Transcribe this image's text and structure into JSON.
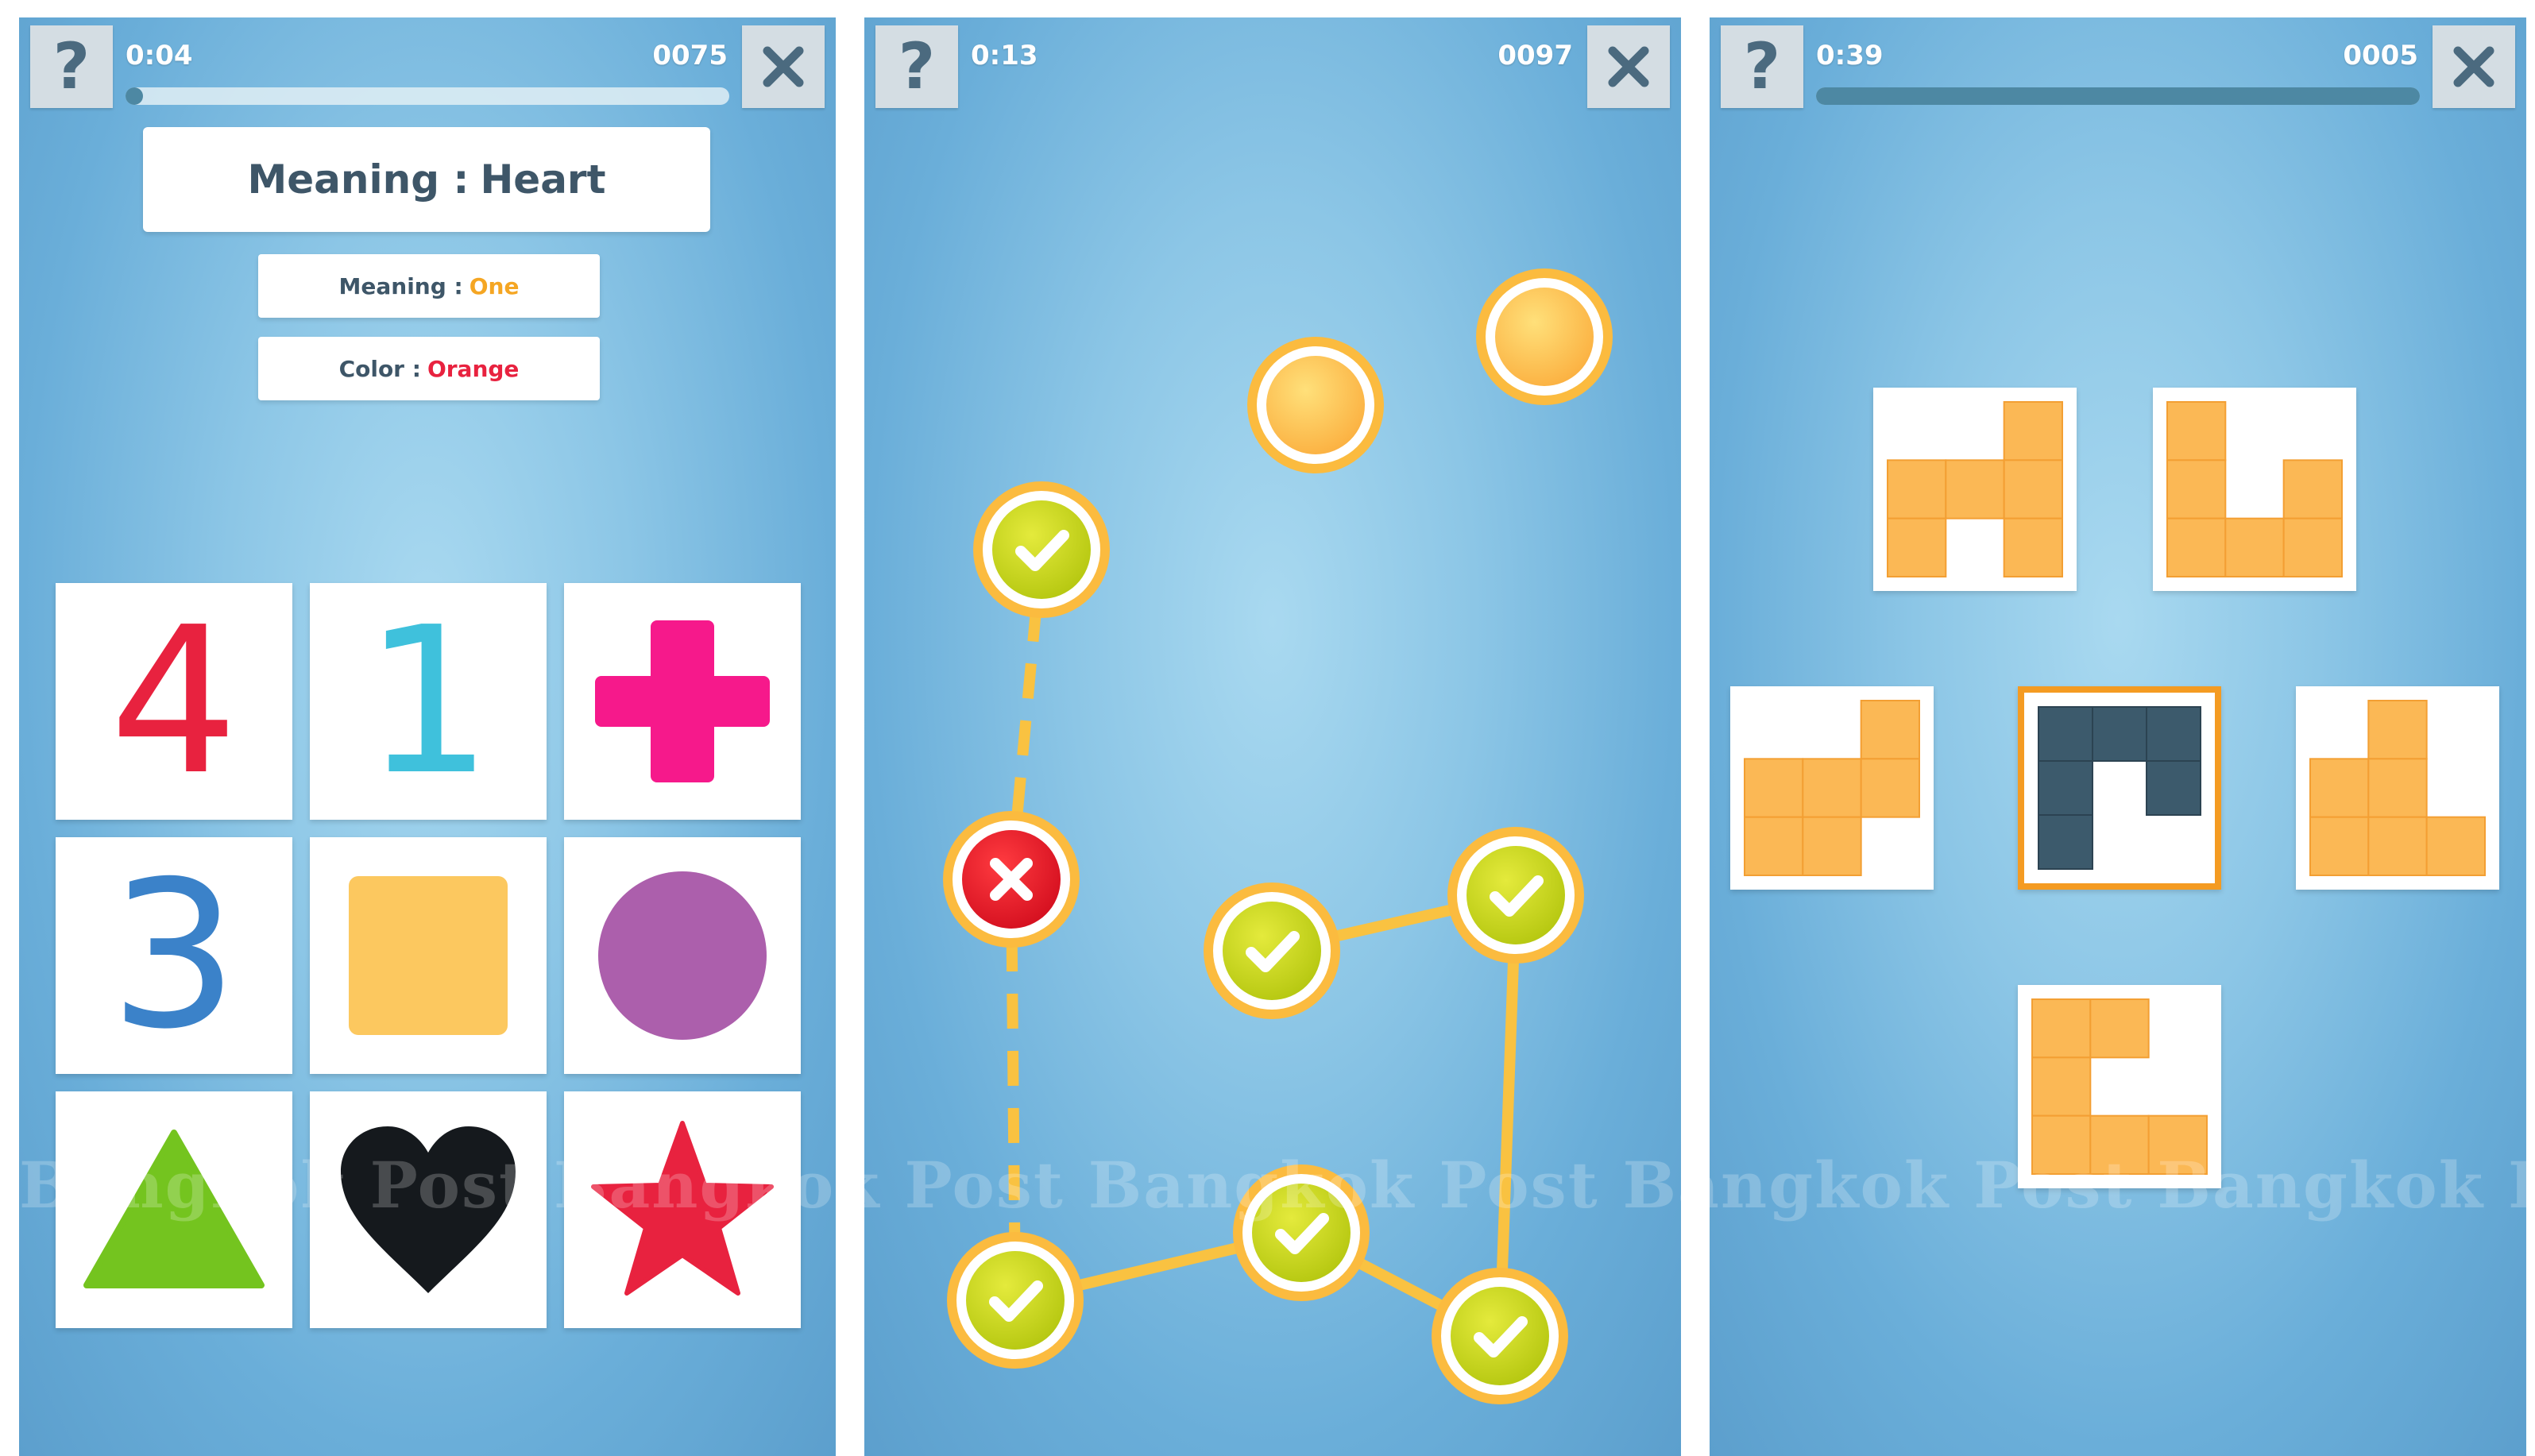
{
  "screens": [
    {
      "help_label": "?",
      "timer": "0:04",
      "score": "0075",
      "progress": 0.0,
      "main_clue": {
        "label": "Meaning :",
        "value": "Heart"
      },
      "clue_meaning": {
        "label": "Meaning :",
        "value": "One"
      },
      "clue_color": {
        "label": "Color :",
        "value": "Orange"
      },
      "tiles": [
        {
          "kind": "digit",
          "text": "4",
          "color": "#e8223f"
        },
        {
          "kind": "digit",
          "text": "1",
          "color": "#3fc1dc"
        },
        {
          "kind": "shape",
          "icon": "cross-icon",
          "color": "#f6198b"
        },
        {
          "kind": "digit",
          "text": "3",
          "color": "#3b82c9"
        },
        {
          "kind": "shape",
          "icon": "square-icon",
          "color": "#fcc85f"
        },
        {
          "kind": "shape",
          "icon": "circle-icon",
          "color": "#ac5fac"
        },
        {
          "kind": "shape",
          "icon": "triangle-icon",
          "color": "#74c41f"
        },
        {
          "kind": "shape",
          "icon": "heart-icon",
          "color": "#15191d"
        },
        {
          "kind": "shape",
          "icon": "star-icon",
          "color": "#e8223f"
        }
      ]
    },
    {
      "help_label": "?",
      "timer": "0:13",
      "score": "0097",
      "nodes": [
        {
          "state": "empty"
        },
        {
          "state": "empty"
        },
        {
          "state": "correct"
        },
        {
          "state": "wrong"
        },
        {
          "state": "correct"
        },
        {
          "state": "correct"
        },
        {
          "state": "correct"
        },
        {
          "state": "correct"
        },
        {
          "state": "correct"
        }
      ]
    },
    {
      "help_label": "?",
      "timer": "0:39",
      "score": "0005",
      "progress": 1.0,
      "pieces": [
        {
          "name": "top-left-piece",
          "cells": [
            [
              0,
              0,
              1
            ],
            [
              1,
              1,
              1
            ],
            [
              1,
              0,
              1
            ]
          ],
          "color": "#fbb855",
          "selected": false
        },
        {
          "name": "top-right-piece",
          "cells": [
            [
              1,
              0,
              0
            ],
            [
              1,
              0,
              1
            ],
            [
              1,
              1,
              1
            ]
          ],
          "color": "#fbb855",
          "selected": false
        },
        {
          "name": "middle-left-piece",
          "cells": [
            [
              0,
              0,
              1
            ],
            [
              1,
              1,
              1
            ],
            [
              1,
              1,
              0
            ]
          ],
          "color": "#fbb855",
          "selected": false
        },
        {
          "name": "center-target-piece",
          "cells": [
            [
              1,
              1,
              1
            ],
            [
              1,
              0,
              1
            ],
            [
              1,
              0,
              0
            ]
          ],
          "color": "#3c5a6c",
          "selected": true
        },
        {
          "name": "middle-right-piece",
          "cells": [
            [
              0,
              1,
              0
            ],
            [
              1,
              1,
              0
            ],
            [
              1,
              1,
              1
            ]
          ],
          "color": "#fbb855",
          "selected": false
        },
        {
          "name": "bottom-piece",
          "cells": [
            [
              1,
              1,
              0
            ],
            [
              1,
              0,
              0
            ],
            [
              1,
              1,
              1
            ]
          ],
          "color": "#fbb855",
          "selected": false
        }
      ]
    }
  ],
  "watermark": "Bangkok Post Bangkok Post Bangkok Post Bangkok Post Bangkok Post Ban"
}
